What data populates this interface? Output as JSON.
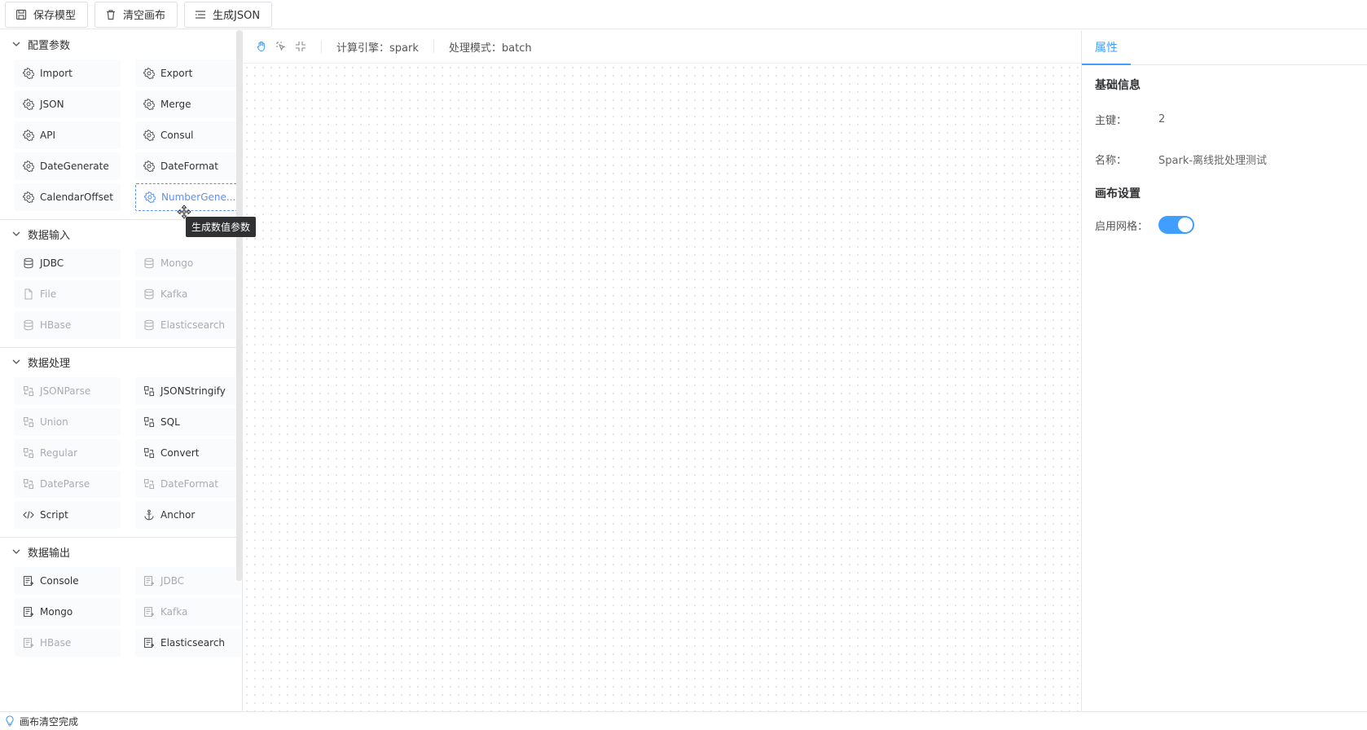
{
  "toolbar": {
    "save_label": "保存模型",
    "clear_label": "清空画布",
    "json_label": "生成JSON"
  },
  "left": {
    "groups": [
      {
        "title": "配置参数",
        "items": [
          {
            "label": "Import",
            "icon": "gear-icon",
            "state": "normal"
          },
          {
            "label": "Export",
            "icon": "gear-icon",
            "state": "normal"
          },
          {
            "label": "JSON",
            "icon": "gear-icon",
            "state": "normal"
          },
          {
            "label": "Merge",
            "icon": "gear-icon",
            "state": "normal"
          },
          {
            "label": "API",
            "icon": "gear-icon",
            "state": "normal"
          },
          {
            "label": "Consul",
            "icon": "gear-icon",
            "state": "normal"
          },
          {
            "label": "DateGenerate",
            "icon": "gear-icon",
            "state": "normal"
          },
          {
            "label": "DateFormat",
            "icon": "gear-icon",
            "state": "normal"
          },
          {
            "label": "CalendarOffset",
            "icon": "gear-icon",
            "state": "normal"
          },
          {
            "label": "NumberGene...",
            "icon": "gear-icon",
            "state": "active"
          }
        ]
      },
      {
        "title": "数据输入",
        "items": [
          {
            "label": "JDBC",
            "icon": "database-icon",
            "state": "normal"
          },
          {
            "label": "Mongo",
            "icon": "database-icon",
            "state": "dim"
          },
          {
            "label": "File",
            "icon": "file-icon",
            "state": "dim"
          },
          {
            "label": "Kafka",
            "icon": "database-icon",
            "state": "dim"
          },
          {
            "label": "HBase",
            "icon": "database-icon",
            "state": "dim"
          },
          {
            "label": "Elasticsearch",
            "icon": "database-icon",
            "state": "dim"
          }
        ]
      },
      {
        "title": "数据处理",
        "items": [
          {
            "label": "JSONParse",
            "icon": "transform-icon",
            "state": "dim"
          },
          {
            "label": "JSONStringify",
            "icon": "transform-icon",
            "state": "normal"
          },
          {
            "label": "Union",
            "icon": "transform-icon",
            "state": "dim"
          },
          {
            "label": "SQL",
            "icon": "transform-icon",
            "state": "normal"
          },
          {
            "label": "Regular",
            "icon": "transform-icon",
            "state": "dim"
          },
          {
            "label": "Convert",
            "icon": "transform-icon",
            "state": "normal"
          },
          {
            "label": "DateParse",
            "icon": "transform-icon",
            "state": "dim"
          },
          {
            "label": "DateFormat",
            "icon": "transform-icon",
            "state": "dim"
          },
          {
            "label": "Script",
            "icon": "code-icon",
            "state": "normal"
          },
          {
            "label": "Anchor",
            "icon": "anchor-icon",
            "state": "normal"
          }
        ]
      },
      {
        "title": "数据输出",
        "items": [
          {
            "label": "Console",
            "icon": "output-icon",
            "state": "normal"
          },
          {
            "label": "JDBC",
            "icon": "output-icon",
            "state": "dim"
          },
          {
            "label": "Mongo",
            "icon": "output-icon",
            "state": "normal"
          },
          {
            "label": "Kafka",
            "icon": "output-icon",
            "state": "dim"
          },
          {
            "label": "HBase",
            "icon": "output-icon",
            "state": "dim"
          },
          {
            "label": "Elasticsearch",
            "icon": "output-icon",
            "state": "normal"
          }
        ]
      }
    ],
    "tooltip": "生成数值参数"
  },
  "canvas": {
    "engine_label": "计算引擎：spark",
    "mode_label": "处理模式：batch"
  },
  "right": {
    "tab_label": "属性",
    "basic_title": "基础信息",
    "key_label": "主键：",
    "key_value": "2",
    "name_label": "名称：",
    "name_value": "Spark-离线批处理测试",
    "canvas_title": "画布设置",
    "grid_label": "启用网格：",
    "grid_enabled": true
  },
  "status": {
    "message": "画布清空完成"
  },
  "colors": {
    "accent": "#409eff",
    "active_item": "#5b8ff9"
  }
}
